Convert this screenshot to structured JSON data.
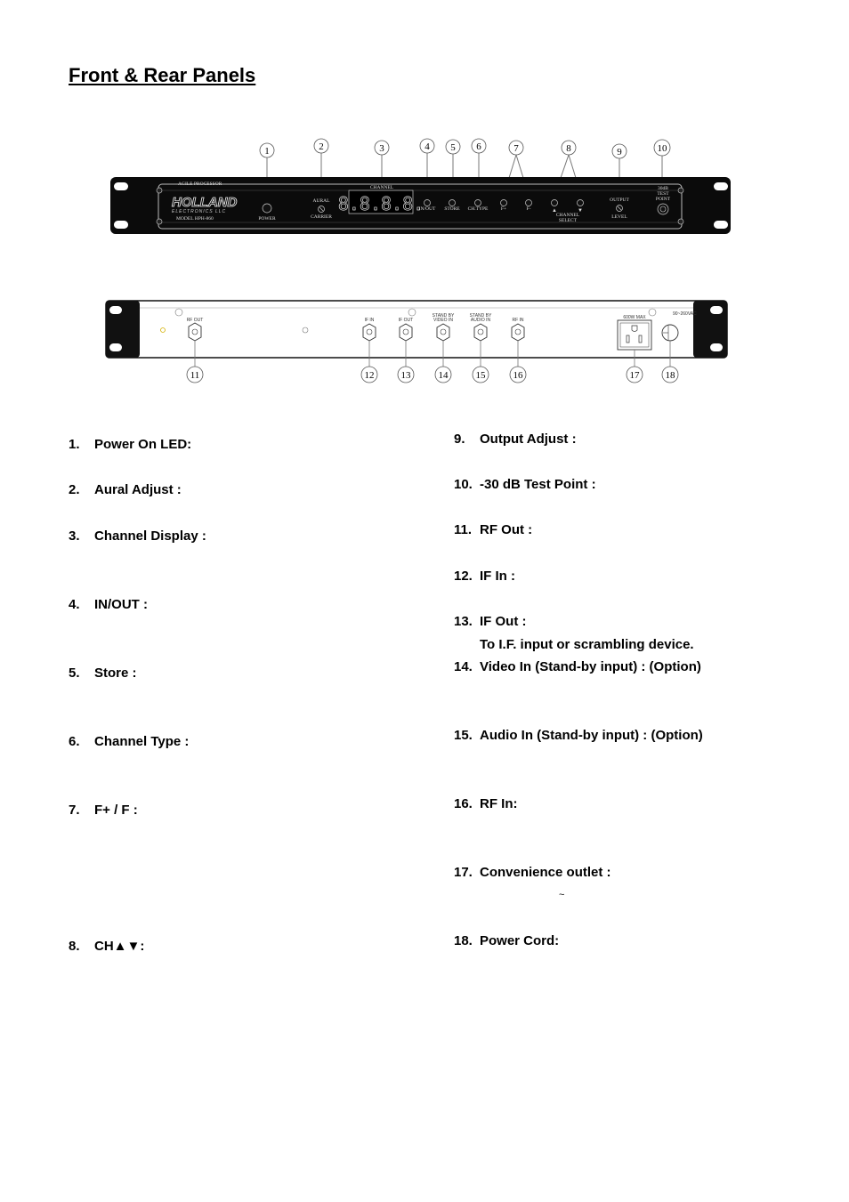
{
  "page": {
    "title": "Front & Rear Panels"
  },
  "front_panel": {
    "product_line": "AGILE PROCESSOR",
    "brand": "HOLLAND",
    "brand_sub": "ELECTRONICS LLC",
    "model": "MODEL  HPH-860",
    "display_label": "CHANNEL",
    "display_value": "8.8.8.8.",
    "controls": {
      "power": "POWER",
      "aural_top": "AURAL",
      "aural_bottom": "CARRIER",
      "in_out": "IN/OUT",
      "store": "STORE",
      "ch_type": "CH.TYPE",
      "f_plus": "F+",
      "f_minus": "F-",
      "up_arrow": "▲",
      "down_arrow": "▼",
      "channel_select_1": "CHANNEL",
      "channel_select_2": "SELECT",
      "output_top": "OUTPUT",
      "output_bottom": "LEVEL",
      "test_1": "30dB",
      "test_2": "TEST",
      "test_3": "POINT"
    },
    "callouts": [
      "1",
      "2",
      "3",
      "4",
      "5",
      "6",
      "7",
      "8",
      "9",
      "10"
    ]
  },
  "rear_panel": {
    "labels": {
      "rf_out": "RF OUT",
      "if_in": "IF IN",
      "if_out": "IF OUT",
      "standby_video_1": "STAND BY",
      "standby_video_2": "VIDEO IN",
      "standby_audio_1": "STAND BY",
      "standby_audio_2": "AUDIO IN",
      "rf_in": "RF IN",
      "outlet_max": "600W MAX",
      "voltage": "90~260VAC"
    },
    "callouts": [
      "11",
      "12",
      "13",
      "14",
      "15",
      "16",
      "17",
      "18"
    ]
  },
  "items_left": [
    {
      "num": "1.",
      "label": "Power On LED:"
    },
    {
      "num": "2.",
      "label": "Aural Adjust :"
    },
    {
      "num": "3.",
      "label": "Channel Display :"
    },
    {
      "num": "4.",
      "label": "IN/OUT :"
    },
    {
      "num": "5.",
      "label": "Store :"
    },
    {
      "num": "6.",
      "label": "Channel Type :"
    },
    {
      "num": "7.",
      "label": "F+ / F :"
    },
    {
      "num": "8.",
      "label": "CH▲▼:"
    }
  ],
  "items_right": [
    {
      "num": "9.",
      "label": "Output Adjust :"
    },
    {
      "num": "10.",
      "label": "-30 dB Test Point :"
    },
    {
      "num": "11.",
      "label": "RF Out :"
    },
    {
      "num": "12.",
      "label": "IF In :"
    },
    {
      "num": "13.",
      "label": "IF Out :"
    },
    {
      "num": "14.",
      "label": "Video In (Stand-by input) : (Option)"
    },
    {
      "num": "15.",
      "label": "Audio In (Stand-by input) : (Option)"
    },
    {
      "num": "16.",
      "label": "RF In:"
    },
    {
      "num": "17.",
      "label": "Convenience outlet :"
    },
    {
      "num": "18.",
      "label": "Power Cord:"
    }
  ],
  "item13_description": "To I.F. input or scrambling device.",
  "item17_tilde": "~"
}
